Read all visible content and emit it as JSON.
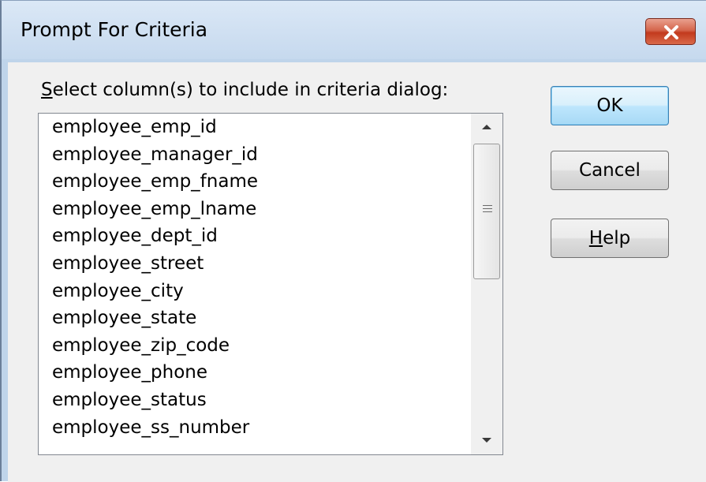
{
  "window": {
    "title": "Prompt For Criteria"
  },
  "instruction": {
    "mnemonic": "S",
    "rest": "elect column(s) to include in criteria dialog:"
  },
  "columns": [
    "employee_emp_id",
    "employee_manager_id",
    "employee_emp_fname",
    "employee_emp_lname",
    "employee_dept_id",
    "employee_street",
    "employee_city",
    "employee_state",
    "employee_zip_code",
    "employee_phone",
    "employee_status",
    "employee_ss_number"
  ],
  "buttons": {
    "ok": "OK",
    "cancel": "Cancel",
    "help_mnemonic": "H",
    "help_rest": "elp"
  },
  "icons": {
    "close": "close-icon",
    "scroll_up": "scroll-up-arrow-icon",
    "scroll_down": "scroll-down-arrow-icon",
    "grip": "scrollbar-grip-icon"
  },
  "colors": {
    "titlebar": "#c6d9ee",
    "close_button": "#c23a1d",
    "dialog_background": "#f0f0f0",
    "default_button_border": "#3c7fb1"
  }
}
